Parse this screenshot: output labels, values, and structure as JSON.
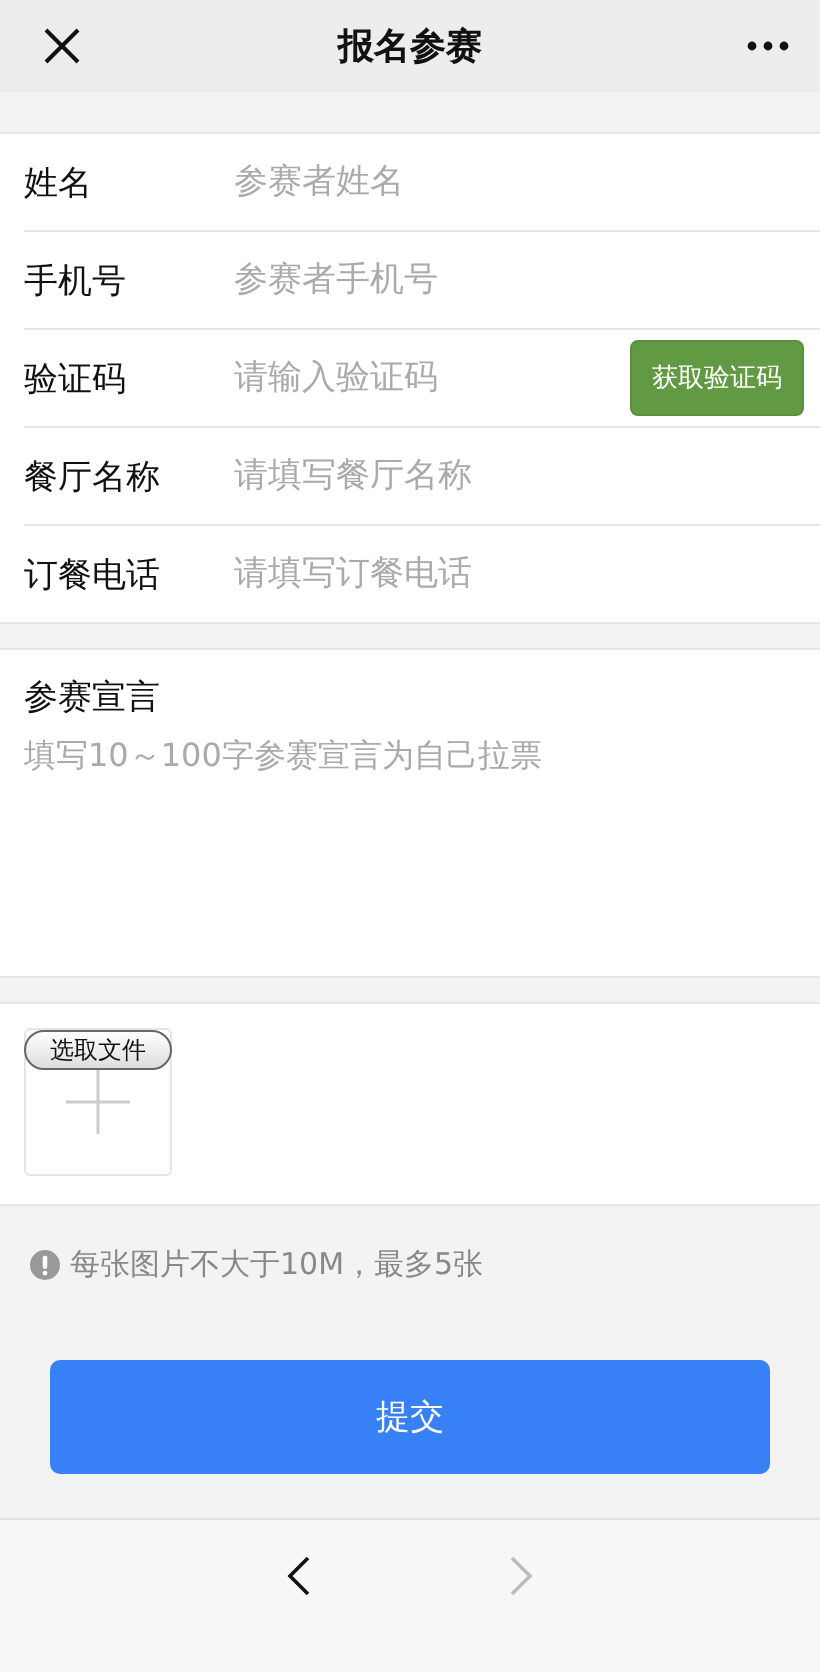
{
  "header": {
    "title": "报名参赛"
  },
  "fields": [
    {
      "label": "姓名",
      "placeholder": "参赛者姓名",
      "kind": "text"
    },
    {
      "label": "手机号",
      "placeholder": "参赛者手机号",
      "kind": "text"
    },
    {
      "label": "验证码",
      "placeholder": "请输入验证码",
      "kind": "code",
      "button": "获取验证码"
    },
    {
      "label": "餐厅名称",
      "placeholder": "请填写餐厅名称",
      "kind": "text"
    },
    {
      "label": "订餐电话",
      "placeholder": "请填写订餐电话",
      "kind": "text"
    }
  ],
  "declaration": {
    "label": "参赛宣言",
    "placeholder": "填写10～100字参赛宣言为自己拉票"
  },
  "upload": {
    "button": "选取文件"
  },
  "tip": "每张图片不大于10M，最多5张",
  "submit": "提交",
  "nav": {
    "back_disabled": false,
    "forward_disabled": true
  }
}
